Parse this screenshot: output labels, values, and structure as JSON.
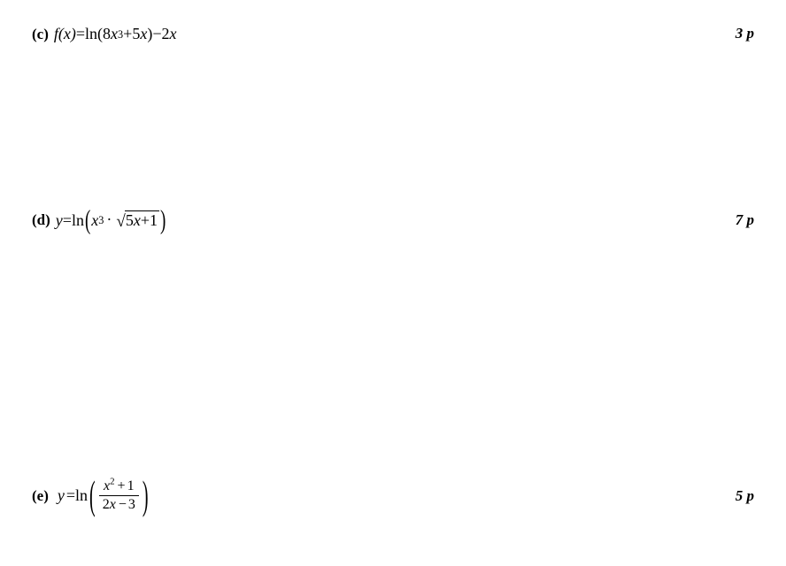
{
  "problems": {
    "c": {
      "label": "(c)",
      "lhs": "f",
      "lhs_arg": "(x)",
      "eq": " = ",
      "ln": "ln",
      "open": "(",
      "term1_coef": "8",
      "term1_var": "x",
      "term1_exp": "3",
      "plus": " + ",
      "term2_coef": "5",
      "term2_var": "x",
      "close": ")",
      "minus": " − ",
      "term3_coef": "2",
      "term3_var": "x",
      "points": "3 p"
    },
    "d": {
      "label": "(d)",
      "lhs": "y",
      "eq": " = ",
      "ln": "ln",
      "open": "(",
      "factor1_var": "x",
      "factor1_exp": "3",
      "dot": "·",
      "rad_coef": "5",
      "rad_var": "x",
      "rad_plus": " + ",
      "rad_const": "1",
      "close": ")",
      "points": "7 p"
    },
    "e": {
      "label": "(e)",
      "lhs": "y",
      "eq": " = ",
      "ln": "ln",
      "num_var": "x",
      "num_exp": "2",
      "num_plus": " + ",
      "num_const": "1",
      "den_coef": "2",
      "den_var": "x",
      "den_minus": " − ",
      "den_const": "3",
      "points": "5 p"
    }
  }
}
